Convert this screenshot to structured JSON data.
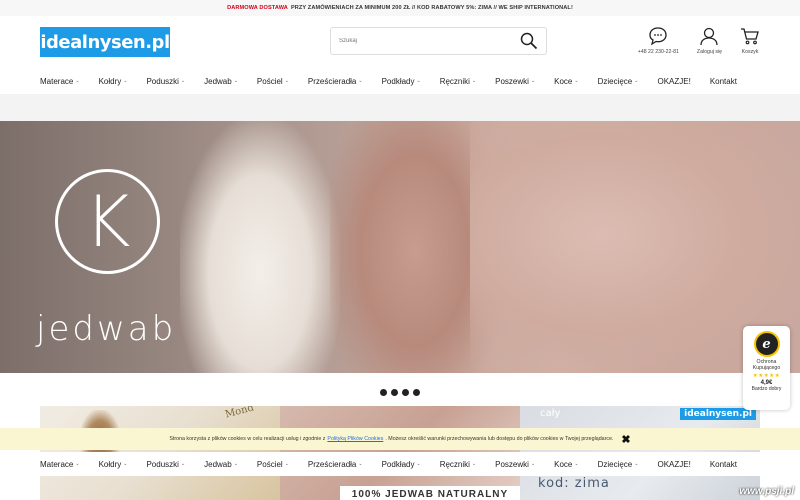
{
  "topbar": {
    "highlight": "DARMOWA DOSTAWA",
    "text": "PRZY ZAMÓWIENIACH ZA MINIMUM 200 ZŁ // KOD RABATOWY 5%: ZIMA // WE SHIP INTERNATIONAL!"
  },
  "header": {
    "logo_text": "idealnysen.pl",
    "search_placeholder": "Szukaj",
    "phone": "+48 22 230-22-81",
    "login_label": "Zaloguj się",
    "cart_label": "Koszyk"
  },
  "nav": {
    "items": [
      {
        "label": "Materace",
        "has_menu": true
      },
      {
        "label": "Kołdry",
        "has_menu": true
      },
      {
        "label": "Poduszki",
        "has_menu": true
      },
      {
        "label": "Jedwab",
        "has_menu": true
      },
      {
        "label": "Pościel",
        "has_menu": true
      },
      {
        "label": "Prześcieradła",
        "has_menu": true
      },
      {
        "label": "Podkłady",
        "has_menu": true
      },
      {
        "label": "Ręczniki",
        "has_menu": true
      },
      {
        "label": "Poszewki",
        "has_menu": true
      },
      {
        "label": "Koce",
        "has_menu": true
      },
      {
        "label": "Dziecięce",
        "has_menu": true
      },
      {
        "label": "OKAZJE!",
        "has_menu": false
      },
      {
        "label": "Kontakt",
        "has_menu": false
      }
    ],
    "chevron": "⌄"
  },
  "hero": {
    "logo_letter": "K",
    "caption": "jedwab"
  },
  "slider": {
    "dot_count": 4
  },
  "tiles": {
    "tile1_text": "Mond",
    "tile2_banner": "100% JEDWAB NATURALNY",
    "tile3_logo": "idealnysen.pl",
    "tile3_top": "cały",
    "tile3_code": "kod: zima"
  },
  "cookie": {
    "text_before": "Strona korzysta z plików cookies w celu realizacji usług i zgodnie z",
    "link1": "Polityką Plików Cookies",
    "text_after": ". Możesz określić warunki przechowywania lub dostępu do plików cookies w Twojej przeglądarce.",
    "close": "✖"
  },
  "trust_badge": {
    "seal": "e",
    "line1": "Ochrona Kupującego",
    "stars": "★★★★★",
    "score": "4,9€",
    "rating_text": "Bardzo dobry"
  },
  "watermark": "www.psji.pl",
  "colors": {
    "brand_blue": "#1e9be6",
    "topbar_red": "#d0021b",
    "cookie_bg": "#fbf6d2",
    "trust_gold": "#f5c400"
  }
}
